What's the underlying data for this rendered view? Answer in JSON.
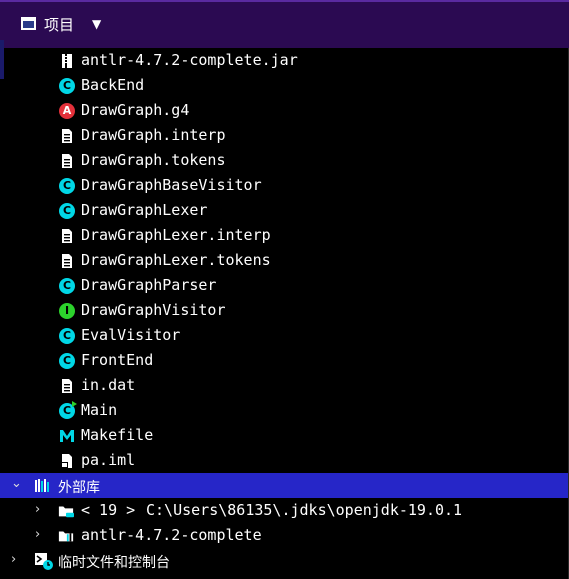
{
  "panel": {
    "title": "项目",
    "dropdown_icon": "caret-down-icon",
    "title_icon": "project-window-icon"
  },
  "colors": {
    "header_bg": "#2b0a52",
    "selected_row": "#2626c8",
    "class_icon": "#00d7e6",
    "antlr_icon": "#e3303a",
    "interface_icon": "#2cd22c",
    "path_text": "#d08a2a"
  },
  "files": [
    {
      "name": "antlr-4.7.2-complete.jar",
      "icon": "jar-icon"
    },
    {
      "name": "BackEnd",
      "icon": "class-icon"
    },
    {
      "name": "DrawGraph.g4",
      "icon": "antlr-icon"
    },
    {
      "name": "DrawGraph.interp",
      "icon": "text-file-icon"
    },
    {
      "name": "DrawGraph.tokens",
      "icon": "text-file-icon"
    },
    {
      "name": "DrawGraphBaseVisitor",
      "icon": "class-icon"
    },
    {
      "name": "DrawGraphLexer",
      "icon": "class-icon"
    },
    {
      "name": "DrawGraphLexer.interp",
      "icon": "text-file-icon"
    },
    {
      "name": "DrawGraphLexer.tokens",
      "icon": "text-file-icon"
    },
    {
      "name": "DrawGraphParser",
      "icon": "class-icon"
    },
    {
      "name": "DrawGraphVisitor",
      "icon": "interface-icon"
    },
    {
      "name": "EvalVisitor",
      "icon": "class-icon"
    },
    {
      "name": "FrontEnd",
      "icon": "class-icon"
    },
    {
      "name": "in.dat",
      "icon": "text-file-icon"
    },
    {
      "name": "Main",
      "icon": "main-class-icon"
    },
    {
      "name": "Makefile",
      "icon": "makefile-icon"
    },
    {
      "name": "pa.iml",
      "icon": "module-file-icon"
    }
  ],
  "external_libraries": {
    "label": "外部库",
    "icon": "library-icon",
    "expanded": true,
    "children": [
      {
        "prefix": "< 19 >",
        "path": "C:\\Users\\86135\\.jdks\\openjdk-19.0.1",
        "icon": "jdk-folder-icon"
      },
      {
        "prefix": "",
        "path": "antlr-4.7.2-complete",
        "icon": "library-jar-icon"
      }
    ]
  },
  "scratches": {
    "label": "临时文件和控制台",
    "icon": "scratches-icon"
  }
}
